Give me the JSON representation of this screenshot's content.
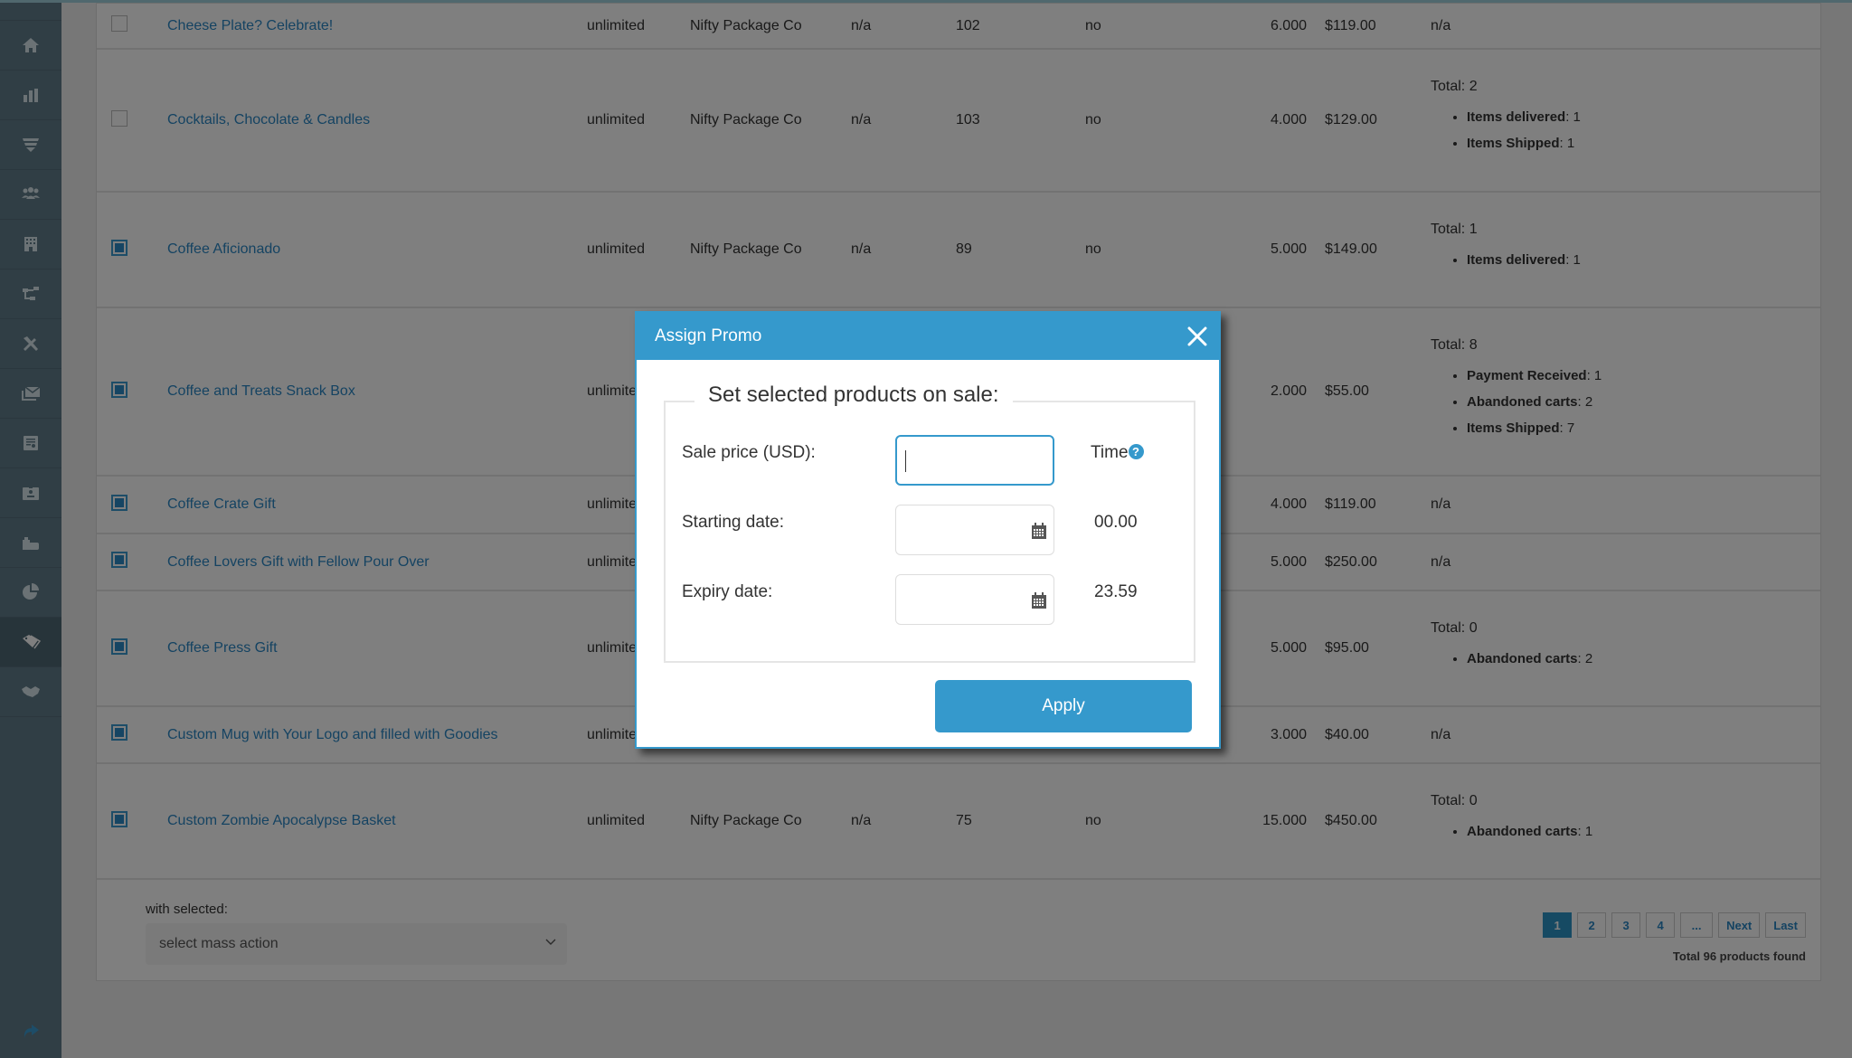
{
  "sidebar": {
    "items": [
      {
        "icon": "home-icon"
      },
      {
        "icon": "bar-chart-icon"
      },
      {
        "icon": "funnel-icon"
      },
      {
        "icon": "users-icon"
      },
      {
        "icon": "building-icon"
      },
      {
        "icon": "sitemap-icon"
      },
      {
        "icon": "tools-icon"
      },
      {
        "icon": "envelopes-icon"
      },
      {
        "icon": "invoice-icon"
      },
      {
        "icon": "id-badge-icon"
      },
      {
        "icon": "briefcase-icon"
      },
      {
        "icon": "pie-chart-icon"
      },
      {
        "icon": "tags-icon",
        "active": true
      },
      {
        "icon": "handshake-icon"
      }
    ],
    "bottom_icon": "share-arrow-icon"
  },
  "products": [
    {
      "checked": false,
      "name": "Cheese Plate? Celebrate!",
      "stock": "unlimited",
      "vendor": "Nifty Package Co",
      "col4": "n/a",
      "col5": "102",
      "col6": "no",
      "weight": "6.000",
      "price": "$119.00",
      "orders": {
        "text": "n/a"
      }
    },
    {
      "checked": false,
      "name": "Cocktails, Chocolate & Candles",
      "stock": "unlimited",
      "vendor": "Nifty Package Co",
      "col4": "n/a",
      "col5": "103",
      "col6": "no",
      "weight": "4.000",
      "price": "$129.00",
      "orders": {
        "total": "Total: 2",
        "items": [
          {
            "label": "Items delivered",
            "value": ": 1"
          },
          {
            "label": "Items Shipped",
            "value": ": 1"
          }
        ]
      }
    },
    {
      "checked": true,
      "name": "Coffee Aficionado",
      "stock": "unlimited",
      "vendor": "Nifty Package Co",
      "col4": "n/a",
      "col5": "89",
      "col6": "no",
      "weight": "5.000",
      "price": "$149.00",
      "orders": {
        "total": "Total: 1",
        "items": [
          {
            "label": "Items delivered",
            "value": ": 1"
          }
        ]
      }
    },
    {
      "checked": true,
      "name": "Coffee and Treats Snack Box",
      "stock": "unlimited",
      "vendor": "",
      "col4": "",
      "col5": "",
      "col6": "",
      "weight": "2.000",
      "price": "$55.00",
      "orders": {
        "total": "Total: 8",
        "items": [
          {
            "label": "Payment Received",
            "value": ": 1"
          },
          {
            "label": "Abandoned carts",
            "value": ": 2"
          },
          {
            "label": "Items Shipped",
            "value": ": 7"
          }
        ]
      }
    },
    {
      "checked": true,
      "name": "Coffee Crate Gift",
      "stock": "unlimited",
      "vendor": "",
      "col4": "",
      "col5": "",
      "col6": "",
      "weight": "4.000",
      "price": "$119.00",
      "orders": {
        "text": "n/a"
      }
    },
    {
      "checked": true,
      "name": "Coffee Lovers Gift with Fellow Pour Over",
      "stock": "unlimited",
      "vendor": "",
      "col4": "",
      "col5": "",
      "col6": "",
      "weight": "5.000",
      "price": "$250.00",
      "orders": {
        "text": "n/a"
      }
    },
    {
      "checked": true,
      "name": "Coffee Press Gift",
      "stock": "unlimited",
      "vendor": "",
      "col4": "",
      "col5": "",
      "col6": "",
      "weight": "5.000",
      "price": "$95.00",
      "orders": {
        "total": "Total: 0",
        "items": [
          {
            "label": "Abandoned carts",
            "value": ": 2"
          }
        ]
      }
    },
    {
      "checked": true,
      "name": "Custom Mug with Your Logo and filled with Goodies",
      "stock": "unlimited",
      "vendor": "",
      "col4": "",
      "col5": "",
      "col6": "",
      "weight": "3.000",
      "price": "$40.00",
      "orders": {
        "text": "n/a"
      }
    },
    {
      "checked": true,
      "name": "Custom Zombie Apocalypse Basket",
      "stock": "unlimited",
      "vendor": "Nifty Package Co",
      "col4": "n/a",
      "col5": "75",
      "col6": "no",
      "weight": "15.000",
      "price": "$450.00",
      "orders": {
        "total": "Total: 0",
        "items": [
          {
            "label": "Abandoned carts",
            "value": ": 1"
          }
        ]
      }
    }
  ],
  "footer": {
    "with_selected_label": "with selected:",
    "mass_action_placeholder": "select mass action",
    "pagination": [
      "1",
      "2",
      "3",
      "4",
      "...",
      "Next",
      "Last"
    ],
    "current_page": "1",
    "total_found": "Total 96 products found"
  },
  "modal": {
    "title": "Assign Promo",
    "legend": "Set selected products on sale:",
    "sale_price_label": "Sale price (USD):",
    "sale_price_value": "",
    "starting_date_label": "Starting date:",
    "starting_date_value": "",
    "expiry_date_label": "Expiry date:",
    "expiry_date_value": "",
    "time_label": "Time",
    "start_time": "00.00",
    "expiry_time": "23.59",
    "apply_label": "Apply"
  },
  "colors": {
    "accent": "#3599cc",
    "sidebar": "#607d8b",
    "link": "#2a87c4"
  }
}
